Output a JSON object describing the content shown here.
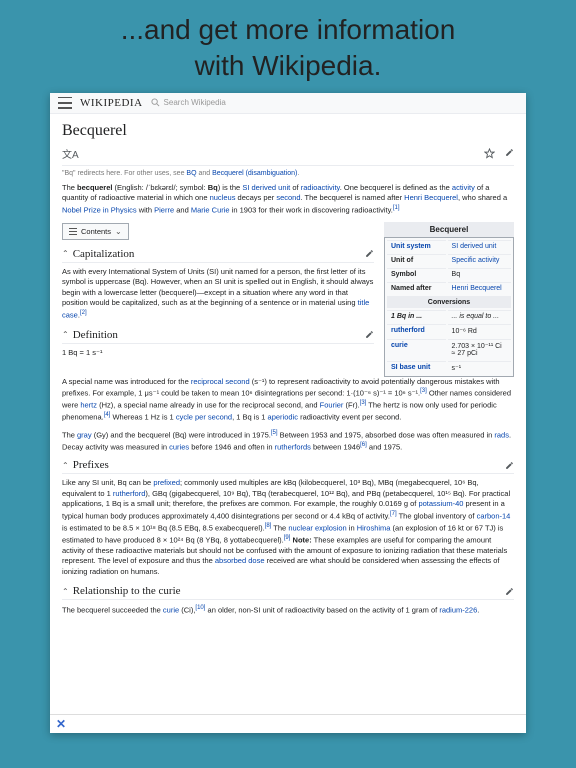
{
  "promo": {
    "line1": "...and get more information",
    "line2": "with Wikipedia."
  },
  "header": {
    "logo": "WIKIPEDIA",
    "search_placeholder": "Search Wikipedia"
  },
  "article": {
    "title": "Becquerel",
    "redirect_prefix": "\"Bq\" redirects here. For other uses, see ",
    "redirect_link1": "BQ",
    "redirect_and": " and ",
    "redirect_link2": "Becquerel (disambiguation)",
    "intro": {
      "t1": "The ",
      "t2": "becquerel",
      "t3": " (English: ",
      "t4": "/ˈbɛkərɛl/",
      "t5": "; symbol: ",
      "t6": "Bq",
      "t7": ") is the ",
      "l1": "SI derived unit",
      "t8": " of ",
      "l2": "radioactivity",
      "t9": ". One becquerel is defined as the ",
      "l3": "activity",
      "t10": " of a quantity of radioactive material in which one ",
      "l4": "nucleus",
      "t11": " decays per ",
      "l5": "second",
      "t12": ". The becquerel is named after ",
      "l6": "Henri Becquerel",
      "t13": ", who shared a ",
      "l7": "Nobel Prize in Physics",
      "t14": " with ",
      "l8": "Pierre",
      "t15": " and ",
      "l9": "Marie Curie",
      "t16": " in 1903 for their work in discovering radioactivity.",
      "ref1": "[1]"
    },
    "toc_label": "Contents",
    "sections": {
      "capitalization": {
        "heading": "Capitalization",
        "body1": "As with every International System of Units (SI) unit named for a person, the first letter of its symbol is uppercase (Bq). However, when an SI unit is spelled out in English, it should always begin with a lowercase letter (becquerel)—except in a situation where any word in that position would be capitalized, such as at the beginning of a sentence or in material using ",
        "link1": "title case",
        "ref": "[2]"
      },
      "definition": {
        "heading": "Definition",
        "eq": "1 Bq = 1 s⁻¹",
        "b1": "A special name was introduced for the ",
        "l1": "reciprocal second",
        "b2": " (s⁻¹) to represent radioactivity to avoid potentially dangerous mistakes with prefixes. For example, 1 μs⁻¹ could be taken to mean 10⁶ disintegrations per second: 1·(10⁻⁶ s)⁻¹ = 10⁶ s⁻¹.",
        "ref1": "[3]",
        "b3": " Other names considered were ",
        "l2": "hertz",
        "b4": " (Hz), a special name already in use for the reciprocal second, and ",
        "l3": "Fourier",
        "b5": " (Fr).",
        "ref2": "[3]",
        "b6": " The hertz is now only used for periodic phenomena.",
        "ref3": "[4]",
        "b7": " Whereas 1 Hz is 1 ",
        "l4": "cycle per second",
        "b8": ", 1 Bq is 1 ",
        "l5": "aperiodic",
        "b9": " radioactivity event per second.",
        "p2a": "The ",
        "p2l1": "gray",
        "p2b": " (Gy) and the becquerel (Bq) were introduced in 1975.",
        "p2ref1": "[5]",
        "p2c": " Between 1953 and 1975, absorbed dose was often measured in ",
        "p2l2": "rads",
        "p2d": ". Decay activity was measured in ",
        "p2l3": "curies",
        "p2e": " before 1946 and often in ",
        "p2l4": "rutherfords",
        "p2f": " between 1946",
        "p2ref2": "[6]",
        "p2g": " and 1975."
      },
      "prefixes": {
        "heading": "Prefixes",
        "b1": "Like any SI unit, Bq can be ",
        "l1": "prefixed",
        "b2": "; commonly used multiples are kBq (kilobecquerel, 10³ Bq), MBq (megabecquerel, 10⁶ Bq, equivalent to 1 ",
        "l2": "rutherford",
        "b3": "), GBq (gigabecquerel, 10⁹ Bq), TBq (terabecquerel, 10¹² Bq), and PBq (petabecquerel, 10¹⁵ Bq). For practical applications, 1 Bq is a small unit; therefore, the prefixes are common. For example, the roughly 0.0169 g of ",
        "l3": "potassium-40",
        "b4": " present in a typical human body produces approximately 4,400 disintegrations per second or 4.4 kBq of activity.",
        "ref1": "[7]",
        "b5": " The global inventory of ",
        "l4": "carbon-14",
        "b6": " is estimated to be 8.5 × 10¹⁸ Bq (8.5 EBq, 8.5 exabecquerel).",
        "ref2": "[8]",
        "b7": " The ",
        "l5": "nuclear explosion",
        "b8": " in ",
        "l6": "Hiroshima",
        "b9": " (an explosion of 16 kt or 67 TJ) is estimated to have produced 8 × 10²⁴ Bq (8 YBq, 8 yottabecquerel).",
        "ref3": "[9]",
        "b10": " ",
        "note": "Note:",
        "b11": " These examples are useful for comparing the amount activity of these radioactive materials but should not be confused with the amount of exposure to ionizing radiation that these materials represent. The level of exposure and thus the ",
        "l7": "absorbed dose",
        "b12": " received are what should be considered when assessing the effects of ionizing radiation on humans."
      },
      "relationship": {
        "heading": "Relationship to the curie",
        "b1": "The becquerel succeeded the ",
        "l1": "curie",
        "b2": " (Ci),",
        "ref1": "[10]",
        "b3": " an older, non-SI unit of radioactivity based on the activity of 1 gram of ",
        "l2": "radium-226",
        "b4": "."
      }
    }
  },
  "infobox": {
    "caption": "Becquerel",
    "rows": {
      "unit_system_h": "Unit system",
      "unit_system_v": "SI derived unit",
      "unit_of_h": "Unit of",
      "unit_of_v": "Specific activity",
      "symbol_h": "Symbol",
      "symbol_v": "Bq",
      "named_after_h": "Named after",
      "named_after_v": "Henri Becquerel",
      "conversions": "Conversions",
      "conv_h1": "1 Bq in ...",
      "conv_h2": "... is equal to ...",
      "r1h": "rutherford",
      "r1v": "10⁻⁶ Rd",
      "r2h": "curie",
      "r2v": "2.703 × 10⁻¹¹ Ci ≈ 27 pCi",
      "r3h": "SI base unit",
      "r3v": "s⁻¹"
    }
  }
}
